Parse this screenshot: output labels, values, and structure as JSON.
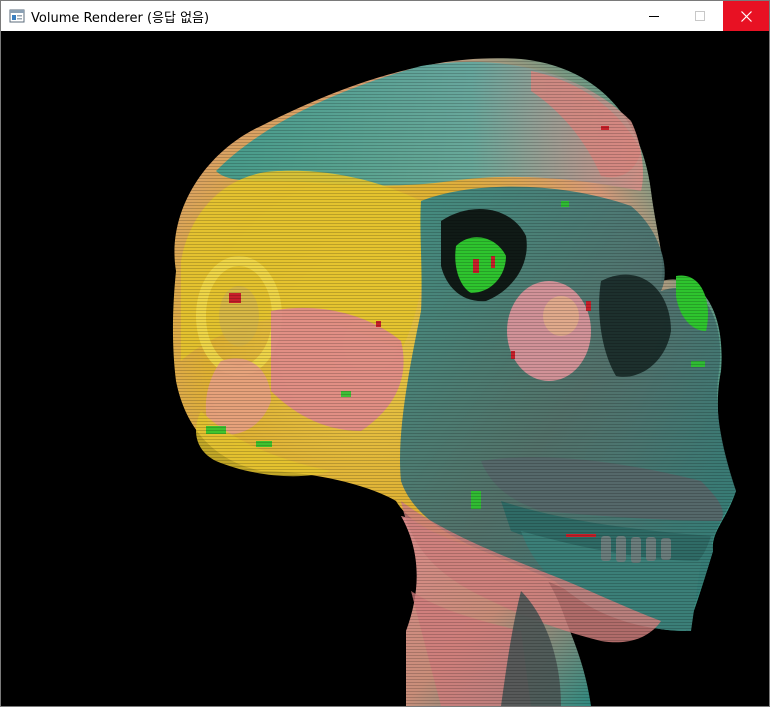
{
  "window": {
    "title": "Volume Renderer (응답 없음)",
    "icons": {
      "app": "app-window-icon",
      "minimize": "minimize-icon",
      "maximize": "maximize-icon",
      "close": "close-icon"
    },
    "colors": {
      "titlebar_bg": "#ffffff",
      "close_button_bg": "#e81123",
      "client_bg": "#000000"
    }
  },
  "render_view": {
    "content": "volume-rendered-skull",
    "palette": {
      "yellow": "#e6c22a",
      "pink": "#e08a8c",
      "teal": "#2f8f86",
      "green": "#2ec42e",
      "gray": "#5a6464",
      "red": "#c8202a"
    }
  }
}
